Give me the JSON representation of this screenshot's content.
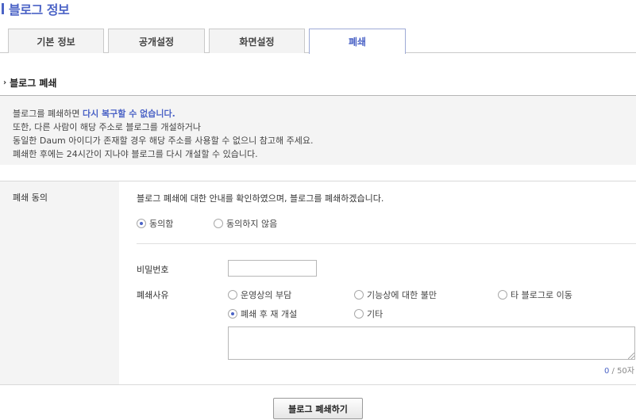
{
  "page_title": "블로그 정보",
  "tabs": [
    {
      "label": "기본 정보",
      "active": false
    },
    {
      "label": "공개설정",
      "active": false
    },
    {
      "label": "화면설정",
      "active": false
    },
    {
      "label": "폐쇄",
      "active": true
    }
  ],
  "section_title": "블로그 폐쇄",
  "notice": {
    "line1_prefix": "블로그를 폐쇄하면 ",
    "line1_highlight": "다시 복구할 수 없습니다.",
    "line2": "또한, 다른 사람이 해당 주소로 블로그를 개설하거나",
    "line3": "동일한 Daum 아이디가 존재할 경우 해당 주소를 사용할 수 없으니 참고해 주세요.",
    "line4": "폐쇄한 후에는 24시간이 지나야 블로그를 다시 개설할 수 있습니다."
  },
  "form": {
    "agree_label": "폐쇄 동의",
    "agree_text": "블로그 폐쇄에 대한 안내를 확인하였으며, 블로그를 폐쇄하겠습니다.",
    "agree_options": [
      {
        "label": "동의함",
        "selected": true
      },
      {
        "label": "동의하지 않음",
        "selected": false
      }
    ],
    "password_label": "비밀번호",
    "password_value": "",
    "reason_label": "폐쇄사유",
    "reason_options": [
      {
        "label": "운영상의 부담",
        "selected": false
      },
      {
        "label": "기능상에 대한 불만",
        "selected": false
      },
      {
        "label": "타 블로그로 이동",
        "selected": false
      },
      {
        "label": "폐쇄 후 재 개설",
        "selected": true
      },
      {
        "label": "기타",
        "selected": false
      }
    ],
    "reason_text": "",
    "counter_current": "0",
    "counter_max": " / 50자"
  },
  "submit_label": "블로그 폐쇄하기",
  "colors": {
    "accent": "#4b63c6",
    "panel_bg": "#f4f4f4",
    "border": "#c9c9c9"
  }
}
